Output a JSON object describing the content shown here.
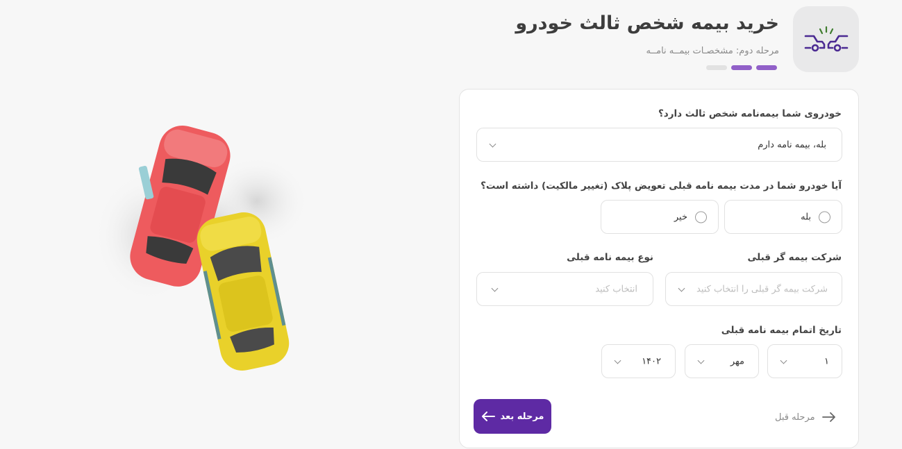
{
  "header": {
    "title": "خرید بیمه شخص ثالث خودرو",
    "subtitle": "مرحله دوم: مشخصـات بیمــه نامــه",
    "steps": [
      {
        "active": false
      },
      {
        "active": true
      },
      {
        "active": true
      }
    ],
    "icon": "car-crash-icon"
  },
  "form": {
    "has_insurance": {
      "label": "خودروی شما بیمه‌نامه شخص ثالث دارد؟",
      "value": "بله، بیمه نامه دارم"
    },
    "plate_change": {
      "label": "آیا خودرو شما در مدت بیمه نامه قبلی تعویض پلاک (تغییر مالکیت) داشته است؟",
      "options": [
        "بله",
        "خیر"
      ]
    },
    "previous_insurer": {
      "label": "شرکت بیمه گر قبلی",
      "placeholder": "شرکت بیمه گر قبلی را انتخاب کنید"
    },
    "previous_policy_type": {
      "label": "نوع بیمه نامه قبلی",
      "placeholder": "انتخاب کنید"
    },
    "expiry_date": {
      "label": "تاریخ اتمام بیمه نامه قبلی",
      "day": "۱",
      "month": "مهر",
      "year": "۱۴۰۲"
    }
  },
  "actions": {
    "next_label": "مرحله بعد",
    "prev_label": "مرحله قبل"
  },
  "colors": {
    "accent": "#5e2aa4",
    "step_active": "#9160c8",
    "background": "#f7f7f7"
  }
}
